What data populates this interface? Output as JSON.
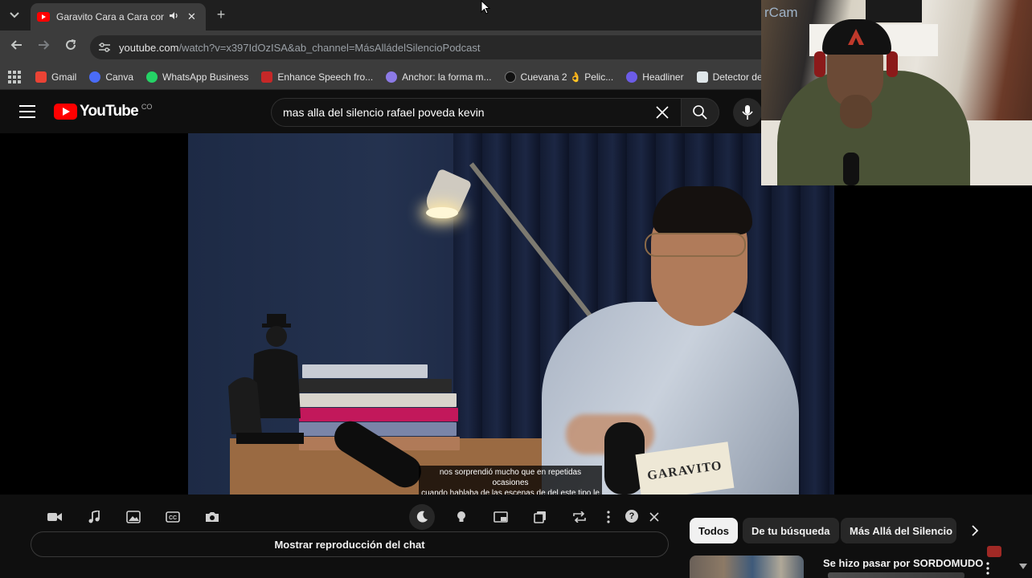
{
  "browser": {
    "tab": {
      "title": "Garavito Cara a Cara con el",
      "audio_icon": "speaker-icon",
      "close_glyph": "✕"
    },
    "new_tab_glyph": "+",
    "omnibox": {
      "host": "youtube.com",
      "path": "/watch?v=x397IdOzISA&ab_channel=MásAlládelSilencioPodcast"
    },
    "bookmarks": [
      {
        "label": "Gmail",
        "color": "#ea4335"
      },
      {
        "label": "Canva",
        "color": "#4a6cf7"
      },
      {
        "label": "WhatsApp Business",
        "color": "#25d366"
      },
      {
        "label": "Enhance Speech fro...",
        "color": "#c62828"
      },
      {
        "label": "Anchor: la forma m...",
        "color": "#8c7ae6"
      },
      {
        "label": "Cuevana 2 👌 Pelic...",
        "color": "#111111"
      },
      {
        "label": "Headliner",
        "color": "#6c5ce7"
      },
      {
        "label": "Detector de plagi",
        "color": "#dfe6e9"
      }
    ]
  },
  "youtube": {
    "logo_text": "YouTube",
    "country_code": "CO",
    "search_query": "mas alla del silencio rafael poveda kevin"
  },
  "webcam": {
    "overlay_text": "rCam"
  },
  "video": {
    "book_title": "GARAVITO",
    "subtitles": [
      "nos sorprendió mucho que en repetidas ocasiones",
      "cuando hablaba de las escenas de del este tipo le"
    ]
  },
  "controls": {
    "chat_button": "Mostrar reproducción del chat",
    "help_glyph": "?"
  },
  "chips": [
    {
      "label": "Todos",
      "active": true
    },
    {
      "label": "De tu búsqueda",
      "active": false
    },
    {
      "label": "Más Allá del Silencio",
      "active": false
    }
  ],
  "related": {
    "title": "Se hizo pasar por SORDOMUDO"
  },
  "colors": {
    "youtube_red": "#ff0000",
    "background": "#0f0f0f",
    "chrome_toolbar": "#3c3c3c"
  }
}
